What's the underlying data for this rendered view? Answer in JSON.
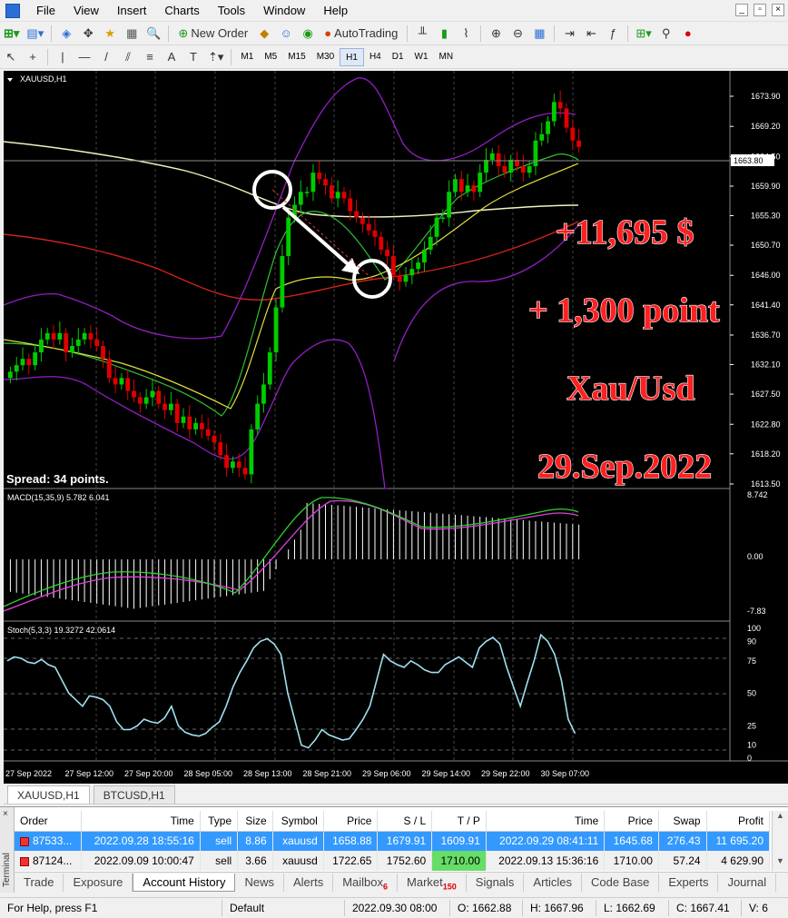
{
  "menu": [
    "File",
    "View",
    "Insert",
    "Charts",
    "Tools",
    "Window",
    "Help"
  ],
  "toolbar": {
    "new_order": "New Order",
    "autotrading": "AutoTrading"
  },
  "timeframes": [
    "M1",
    "M5",
    "M15",
    "M30",
    "H1",
    "H4",
    "D1",
    "W1",
    "MN"
  ],
  "active_timeframe": "H1",
  "chart": {
    "symbol_label": "XAUUSD,H1",
    "spread": "Spread: 34 points.",
    "current_price": "1663.80",
    "price_ticks": [
      "1673.90",
      "1669.20",
      "1664.50",
      "1659.90",
      "1655.30",
      "1650.70",
      "1646.00",
      "1641.40",
      "1636.70",
      "1632.10",
      "1627.50",
      "1622.80",
      "1618.20",
      "1613.50"
    ],
    "macd_label": "MACD(15,35,9) 5.782 6.041",
    "macd_ticks": [
      "8.742",
      "0.00",
      "-7.83"
    ],
    "stoch_label": "Stoch(5,3,3) 19.3272 42.0614",
    "stoch_ticks": [
      "100",
      "90",
      "75",
      "50",
      "25",
      "10",
      "0"
    ],
    "time_ticks": [
      "27 Sep 2022",
      "27 Sep 12:00",
      "27 Sep 20:00",
      "28 Sep 05:00",
      "28 Sep 13:00",
      "28 Sep 21:00",
      "29 Sep 06:00",
      "29 Sep 14:00",
      "29 Sep 22:00",
      "30 Sep 07:00"
    ],
    "overlay": [
      "+11,695 $",
      "+ 1,300 point",
      "Xau/Usd",
      "29.Sep.2022"
    ]
  },
  "symbol_tabs": [
    "XAUUSD,H1",
    "BTCUSD,H1"
  ],
  "terminal": {
    "side_label": "Terminal",
    "headers": [
      "Order",
      "Time",
      "Type",
      "Size",
      "Symbol",
      "Price",
      "S / L",
      "T / P",
      "Time",
      "Price",
      "Swap",
      "Profit"
    ],
    "rows": [
      {
        "order": "87533...",
        "time": "2022.09.28 18:55:16",
        "type": "sell",
        "size": "8.86",
        "symbol": "xauusd",
        "price": "1658.88",
        "sl": "1679.91",
        "tp": "1609.91",
        "close_time": "2022.09.29 08:41:11",
        "close_price": "1645.68",
        "swap": "276.43",
        "profit": "11 695.20"
      },
      {
        "order": "87124...",
        "time": "2022.09.09 10:00:47",
        "type": "sell",
        "size": "3.66",
        "symbol": "xauusd",
        "price": "1722.65",
        "sl": "1752.60",
        "tp": "1710.00",
        "close_time": "2022.09.13 15:36:16",
        "close_price": "1710.00",
        "swap": "57.24",
        "profit": "4 629.90"
      }
    ],
    "tabs": [
      {
        "label": "Trade",
        "badge": ""
      },
      {
        "label": "Exposure",
        "badge": ""
      },
      {
        "label": "Account History",
        "badge": ""
      },
      {
        "label": "News",
        "badge": ""
      },
      {
        "label": "Alerts",
        "badge": ""
      },
      {
        "label": "Mailbox",
        "badge": "6"
      },
      {
        "label": "Market",
        "badge": "150"
      },
      {
        "label": "Signals",
        "badge": ""
      },
      {
        "label": "Articles",
        "badge": ""
      },
      {
        "label": "Code Base",
        "badge": ""
      },
      {
        "label": "Experts",
        "badge": ""
      },
      {
        "label": "Journal",
        "badge": ""
      }
    ],
    "active_tab": "Account History"
  },
  "status": {
    "help": "For Help, press F1",
    "profile": "Default",
    "datetime": "2022.09.30 08:00",
    "open": "O: 1662.88",
    "high": "H: 1667.96",
    "low": "L: 1662.69",
    "close": "C: 1667.41",
    "volume": "V: 6"
  },
  "colors": {
    "bull": "#00cc00",
    "bear": "#e00000",
    "overlay_text": "#ff2020",
    "selected_row": "#3399ff"
  }
}
